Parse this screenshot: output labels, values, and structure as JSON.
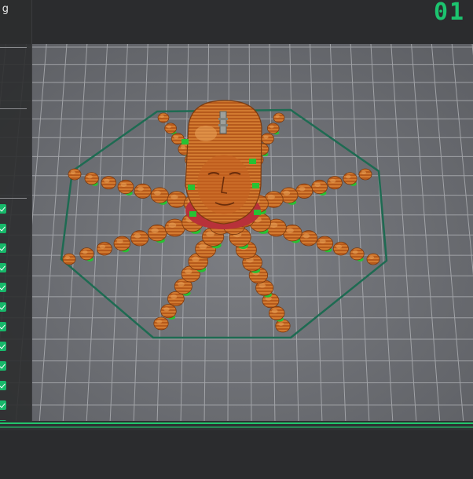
{
  "left_panel": {
    "title": "g",
    "checkbox_states": [
      true,
      true,
      true,
      true,
      true,
      true,
      true,
      true,
      true,
      true,
      true,
      true,
      true,
      true
    ]
  },
  "top_right": {
    "layer_indicator": "01"
  },
  "viewport": {
    "model": "octopus-with-face-head",
    "bed": "grid-build-plate",
    "colors": {
      "background": "#2b2c2e",
      "bed_surface": "#6e7075",
      "grid_line": "#b7b9bd",
      "brim_outline": "#1e6b52",
      "model_orange": "#c8661f",
      "model_highlight": "#e1893e",
      "support_green": "#27c233",
      "accent_green": "#1cc46f"
    }
  },
  "progress": {
    "fraction": 1.0
  }
}
